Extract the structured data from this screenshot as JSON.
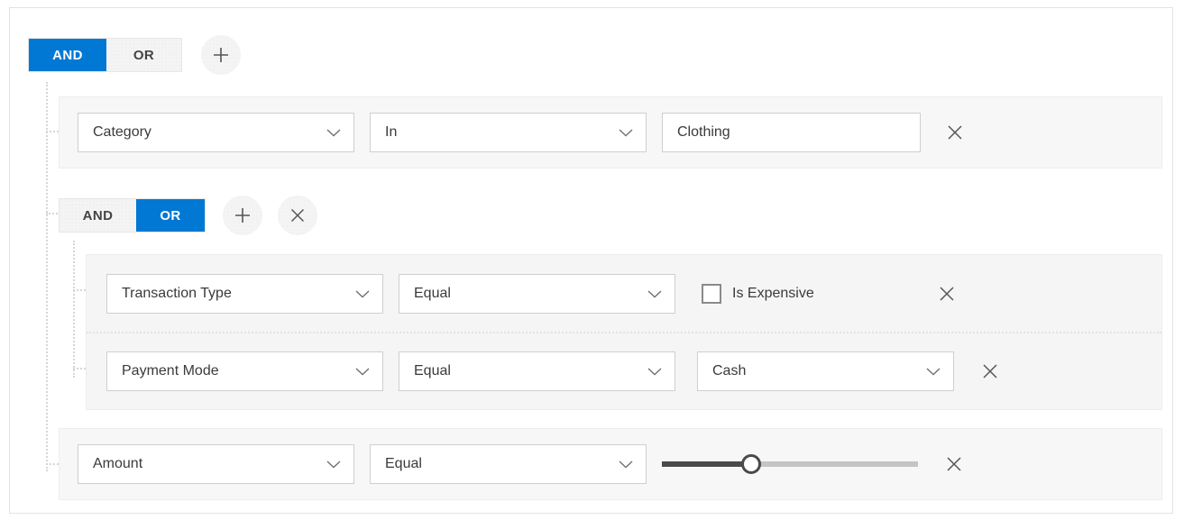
{
  "query_builder": {
    "root_group": {
      "conjunction_selected": "AND",
      "and_label": "AND",
      "or_label": "OR",
      "add_icon": "plus-icon"
    },
    "nested_group": {
      "conjunction_selected": "OR",
      "and_label": "AND",
      "or_label": "OR",
      "add_icon": "plus-icon",
      "remove_icon": "close-icon"
    },
    "rules": [
      {
        "id": "rule-category",
        "field": "Category",
        "operator": "In",
        "value": "Clothing",
        "value_type": "text",
        "delete_icon": "close-icon"
      },
      {
        "id": "rule-transaction-type",
        "field": "Transaction Type",
        "operator": "Equal",
        "value": "Is Expensive",
        "value_type": "checkbox",
        "checked": false,
        "delete_icon": "close-icon"
      },
      {
        "id": "rule-payment-mode",
        "field": "Payment Mode",
        "operator": "Equal",
        "value": "Cash",
        "value_type": "dropdown",
        "delete_icon": "close-icon"
      },
      {
        "id": "rule-amount",
        "field": "Amount",
        "operator": "Equal",
        "value": "",
        "value_type": "slider",
        "slider_percent": 35,
        "delete_icon": "close-icon"
      }
    ],
    "colors": {
      "accent": "#0078d4",
      "row_background": "#f7f7f7",
      "group_background": "#f5f5f5",
      "panel_border": "#e3e3e3",
      "control_border": "#cfcfcf",
      "text": "#3a3a3a",
      "connector": "#d6d6d6",
      "slider_fill": "#4a4a4a"
    }
  }
}
